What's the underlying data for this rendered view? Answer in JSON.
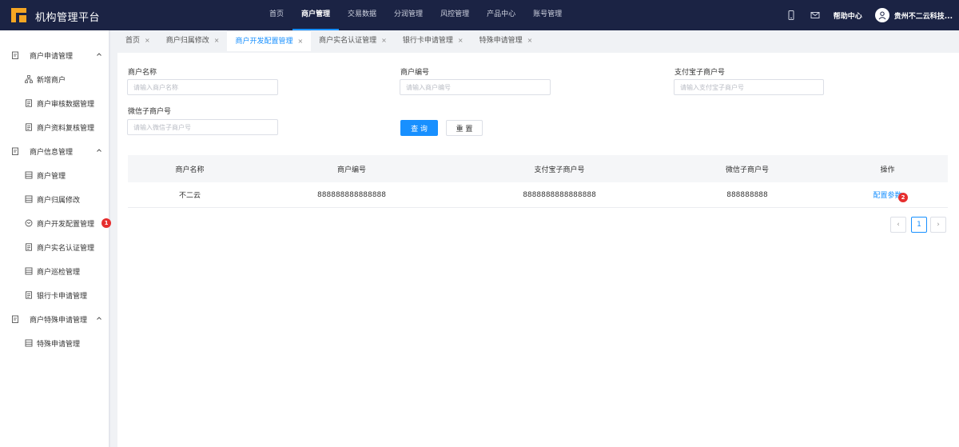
{
  "header": {
    "app_title": "机构管理平台",
    "nav": [
      "首页",
      "商户管理",
      "交易数据",
      "分润管理",
      "风控管理",
      "产品中心",
      "账号管理"
    ],
    "active_nav_index": 1,
    "help_label": "帮助中心",
    "username": "贵州不二云科技..."
  },
  "sidebar": {
    "groups": [
      {
        "label": "商户申请管理",
        "icon": "clipboard-icon",
        "items": [
          {
            "label": "新增商户",
            "icon": "sitemap-icon"
          },
          {
            "label": "商户审核数据管理",
            "icon": "document-icon"
          },
          {
            "label": "商户资料复核管理",
            "icon": "document-icon"
          }
        ]
      },
      {
        "label": "商户信息管理",
        "icon": "clipboard-icon",
        "items": [
          {
            "label": "商户管理",
            "icon": "table-icon"
          },
          {
            "label": "商户归属修改",
            "icon": "table-icon"
          },
          {
            "label": "商户开发配置管理",
            "icon": "config-icon",
            "badge": "1"
          },
          {
            "label": "商户实名认证管理",
            "icon": "document-icon"
          },
          {
            "label": "商户巡检管理",
            "icon": "table-icon"
          },
          {
            "label": "银行卡申请管理",
            "icon": "document-icon"
          }
        ]
      },
      {
        "label": "商户特殊申请管理",
        "icon": "clipboard-icon",
        "items": [
          {
            "label": "特殊申请管理",
            "icon": "table-icon"
          }
        ]
      }
    ]
  },
  "tabs": [
    {
      "label": "首页",
      "active": false
    },
    {
      "label": "商户归属修改",
      "active": false
    },
    {
      "label": "商户开发配置管理",
      "active": true
    },
    {
      "label": "商户实名认证管理",
      "active": false
    },
    {
      "label": "银行卡申请管理",
      "active": false
    },
    {
      "label": "特殊申请管理",
      "active": false
    }
  ],
  "tab_close": "×",
  "filters": {
    "merchant_name": {
      "label": "商户名称",
      "placeholder": "请输入商户名称"
    },
    "merchant_no": {
      "label": "商户编号",
      "placeholder": "请输入商户编号"
    },
    "alipay_sub_no": {
      "label": "支付宝子商户号",
      "placeholder": "请输入支付宝子商户号"
    },
    "wechat_sub_no": {
      "label": "微信子商户号",
      "placeholder": "请输入微信子商户号"
    },
    "query_label": "查 询",
    "reset_label": "重 置"
  },
  "table": {
    "columns": [
      "商户名称",
      "商户编号",
      "支付宝子商户号",
      "微信子商户号",
      "操作"
    ],
    "rows": [
      {
        "name": "不二云",
        "merchant_no": "888888888888888",
        "alipay_sub_no": "8888888888888888",
        "wechat_sub_no": "888888888",
        "action": "配置参数",
        "action_badge": "2"
      }
    ]
  },
  "pagination": {
    "prev": "‹",
    "current": "1",
    "next": "›"
  }
}
